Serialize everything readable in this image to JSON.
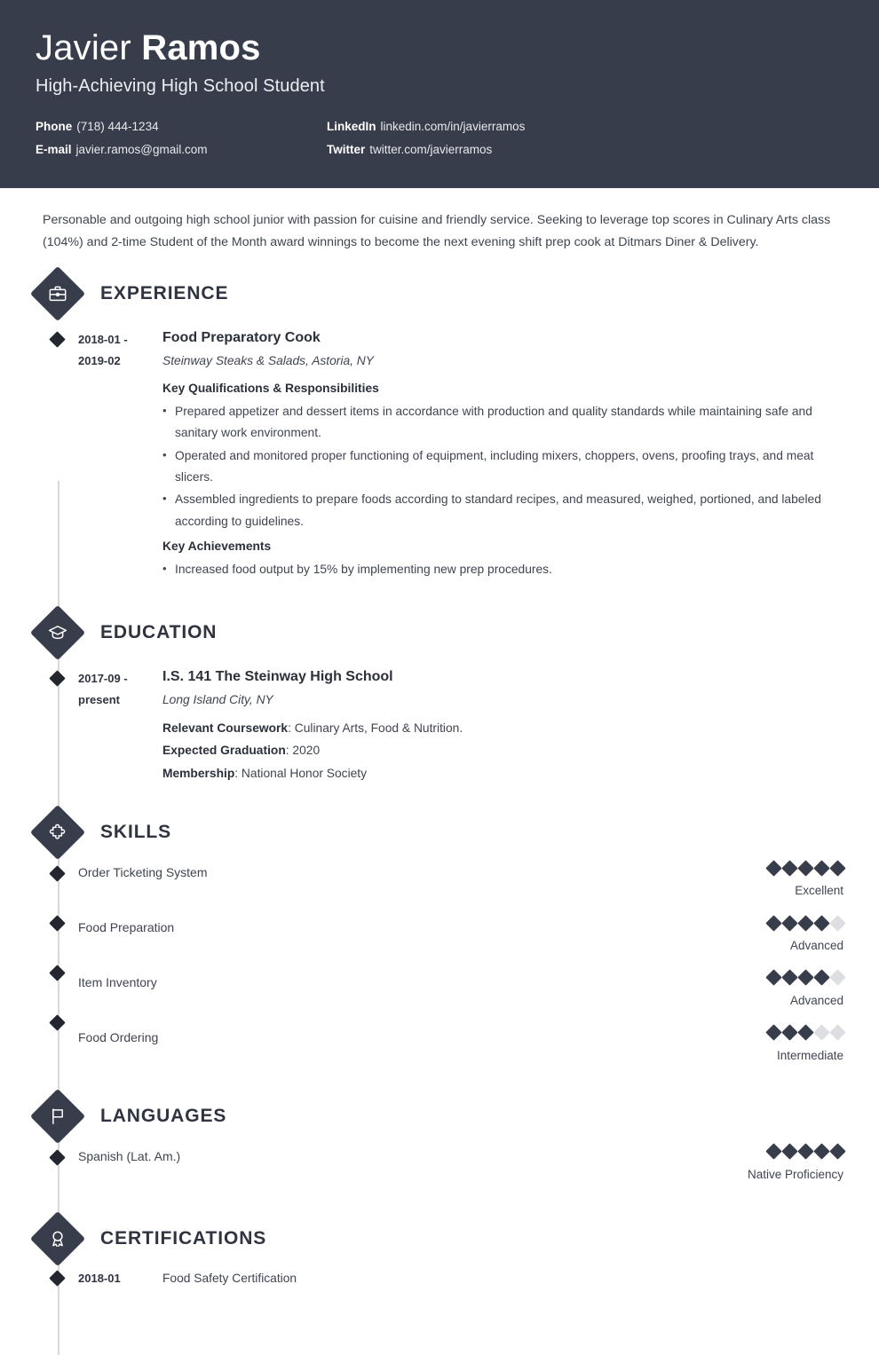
{
  "header": {
    "first_name": "Javier",
    "last_name": "Ramos",
    "job_title": "High-Achieving High School Student",
    "bg_color": "#383d4b",
    "contacts": [
      {
        "key": "Phone",
        "value": "(718) 444-1234"
      },
      {
        "key": "LinkedIn",
        "value": "linkedin.com/in/javierramos"
      },
      {
        "key": "E-mail",
        "value": "javier.ramos@gmail.com"
      },
      {
        "key": "Twitter",
        "value": "twitter.com/javierramos"
      }
    ]
  },
  "summary": "Personable and outgoing high school junior with passion for cuisine and friendly service. Seeking to leverage top scores in Culinary Arts class (104%) and 2-time Student of the Month award winnings to become the next evening shift prep cook at Ditmars Diner & Delivery.",
  "sections": {
    "experience": {
      "title": "EXPERIENCE",
      "icon": "briefcase-icon",
      "entry": {
        "date": "2018-01 - 2019-02",
        "date_line1": "2018-01 -",
        "date_line2": "2019-02",
        "title": "Food Preparatory Cook",
        "subtitle": "Steinway Steaks & Salads, Astoria, NY",
        "qualifications_label": "Key Qualifications & Responsibilities",
        "qualifications": [
          "Prepared appetizer and dessert items in accordance with production and quality standards while maintaining safe and sanitary work environment.",
          "Operated and monitored proper functioning of equipment, including mixers, choppers, ovens, proofing trays, and meat slicers.",
          "Assembled ingredients to prepare foods according to standard recipes, and measured, weighed, portioned, and labeled according to guidelines."
        ],
        "achievements_label": "Key Achievements",
        "achievements": [
          "Increased food output by 15% by implementing new prep procedures."
        ]
      }
    },
    "education": {
      "title": "EDUCATION",
      "icon": "graduation-cap-icon",
      "entry": {
        "date_line1": "2017-09 -",
        "date_line2": "present",
        "title": "I.S. 141 The Steinway High School",
        "subtitle": "Long Island City, NY",
        "details": [
          {
            "label": "Relevant Coursework",
            "value": ": Culinary Arts, Food & Nutrition."
          },
          {
            "label": "Expected Graduation",
            "value": ": 2020"
          },
          {
            "label": "Membership",
            "value": ": National Honor Society"
          }
        ]
      }
    },
    "skills": {
      "title": "SKILLS",
      "icon": "puzzle-piece-icon",
      "max_rating": 5,
      "items": [
        {
          "name": "Order Ticketing System",
          "rating": 5,
          "level": "Excellent"
        },
        {
          "name": "Food Preparation",
          "rating": 4,
          "level": "Advanced"
        },
        {
          "name": "Item Inventory",
          "rating": 4,
          "level": "Advanced"
        },
        {
          "name": "Food Ordering",
          "rating": 3,
          "level": "Intermediate"
        }
      ]
    },
    "languages": {
      "title": "LANGUAGES",
      "icon": "flag-icon",
      "max_rating": 5,
      "items": [
        {
          "name": "Spanish (Lat. Am.)",
          "rating": 5,
          "level": "Native Proficiency"
        }
      ]
    },
    "certifications": {
      "title": "CERTIFICATIONS",
      "icon": "award-ribbon-icon",
      "items": [
        {
          "date": "2018-01",
          "name": "Food Safety Certification"
        }
      ]
    }
  }
}
